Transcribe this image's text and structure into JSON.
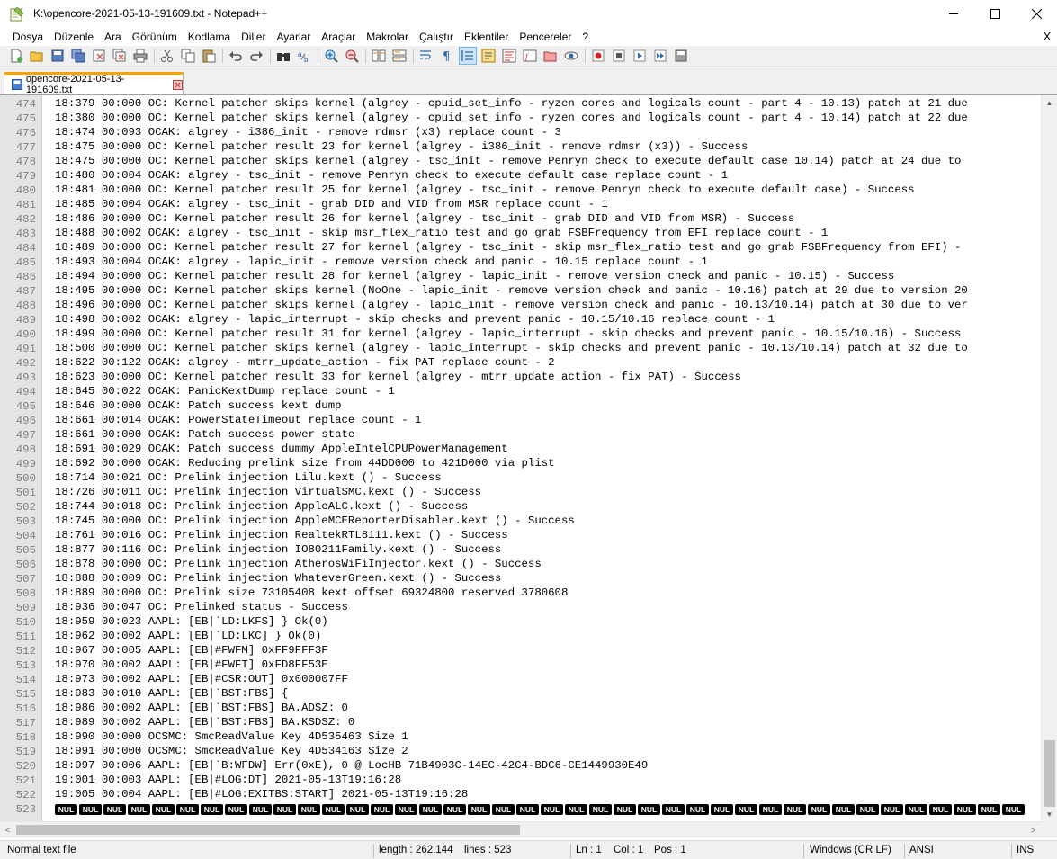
{
  "window": {
    "title": "K:\\opencore-2021-05-13-191609.txt - Notepad++",
    "minimize_icon": "minimize-icon",
    "maximize_icon": "maximize-icon",
    "close_icon": "close-icon"
  },
  "menu": {
    "items": [
      "Dosya",
      "Düzenle",
      "Ara",
      "Görünüm",
      "Kodlama",
      "Diller",
      "Ayarlar",
      "Araçlar",
      "Makrolar",
      "Çalıştır",
      "Eklentiler",
      "Pencereler",
      "?"
    ],
    "close_label": "X"
  },
  "toolbar": {
    "buttons": [
      "new-file",
      "open-file",
      "save",
      "save-all",
      "close",
      "close-all",
      "print",
      "cut",
      "copy",
      "paste",
      "undo",
      "redo",
      "find",
      "replace",
      "zoom-in",
      "zoom-out",
      "sync-vertical",
      "sync-horizontal",
      "word-wrap",
      "show-all-chars",
      "indent-guide",
      "user-lang",
      "doc-map",
      "function-list",
      "folder-as-workspace",
      "monitoring",
      "record-macro",
      "stop-record",
      "play-macro",
      "run-macro-multiple",
      "save-macro"
    ]
  },
  "tab": {
    "label": "opencore-2021-05-13-191609.txt"
  },
  "editor": {
    "lines": [
      {
        "n": "474",
        "t": "18:379 00:000 OC: Kernel patcher skips kernel (algrey - cpuid_set_info - ryzen cores and logicals count - part 4 - 10.13) patch at 21 due"
      },
      {
        "n": "475",
        "t": "18:380 00:000 OC: Kernel patcher skips kernel (algrey - cpuid_set_info - ryzen cores and logicals count - part 4 - 10.14) patch at 22 due"
      },
      {
        "n": "476",
        "t": "18:474 00:093 OCAK: algrey - i386_init - remove rdmsr (x3) replace count - 3"
      },
      {
        "n": "477",
        "t": "18:475 00:000 OC: Kernel patcher result 23 for kernel (algrey - i386_init - remove rdmsr (x3)) - Success"
      },
      {
        "n": "478",
        "t": "18:475 00:000 OC: Kernel patcher skips kernel (algrey - tsc_init - remove Penryn check to execute default case 10.14) patch at 24 due to"
      },
      {
        "n": "479",
        "t": "18:480 00:004 OCAK: algrey - tsc_init - remove Penryn check to execute default case replace count - 1"
      },
      {
        "n": "480",
        "t": "18:481 00:000 OC: Kernel patcher result 25 for kernel (algrey - tsc_init - remove Penryn check to execute default case) - Success"
      },
      {
        "n": "481",
        "t": "18:485 00:004 OCAK: algrey - tsc_init - grab DID and VID from MSR replace count - 1"
      },
      {
        "n": "482",
        "t": "18:486 00:000 OC: Kernel patcher result 26 for kernel (algrey - tsc_init - grab DID and VID from MSR) - Success"
      },
      {
        "n": "483",
        "t": "18:488 00:002 OCAK: algrey - tsc_init - skip msr_flex_ratio test and go grab FSBFrequency from EFI replace count - 1"
      },
      {
        "n": "484",
        "t": "18:489 00:000 OC: Kernel patcher result 27 for kernel (algrey - tsc_init - skip msr_flex_ratio test and go grab FSBFrequency from EFI) -"
      },
      {
        "n": "485",
        "t": "18:493 00:004 OCAK: algrey - lapic_init - remove version check and panic - 10.15 replace count - 1"
      },
      {
        "n": "486",
        "t": "18:494 00:000 OC: Kernel patcher result 28 for kernel (algrey - lapic_init - remove version check and panic - 10.15) - Success"
      },
      {
        "n": "487",
        "t": "18:495 00:000 OC: Kernel patcher skips kernel (NoOne - lapic_init - remove version check and panic - 10.16) patch at 29 due to version 20"
      },
      {
        "n": "488",
        "t": "18:496 00:000 OC: Kernel patcher skips kernel (algrey - lapic_init - remove version check and panic - 10.13/10.14) patch at 30 due to ver"
      },
      {
        "n": "489",
        "t": "18:498 00:002 OCAK: algrey - lapic_interrupt - skip checks and prevent panic - 10.15/10.16 replace count - 1"
      },
      {
        "n": "490",
        "t": "18:499 00:000 OC: Kernel patcher result 31 for kernel (algrey - lapic_interrupt - skip checks and prevent panic - 10.15/10.16) - Success"
      },
      {
        "n": "491",
        "t": "18:500 00:000 OC: Kernel patcher skips kernel (algrey - lapic_interrupt - skip checks and prevent panic - 10.13/10.14) patch at 32 due to"
      },
      {
        "n": "492",
        "t": "18:622 00:122 OCAK: algrey - mtrr_update_action - fix PAT replace count - 2"
      },
      {
        "n": "493",
        "t": "18:623 00:000 OC: Kernel patcher result 33 for kernel (algrey - mtrr_update_action - fix PAT) - Success"
      },
      {
        "n": "494",
        "t": "18:645 00:022 OCAK: PanicKextDump replace count - 1"
      },
      {
        "n": "495",
        "t": "18:646 00:000 OCAK: Patch success kext dump"
      },
      {
        "n": "496",
        "t": "18:661 00:014 OCAK: PowerStateTimeout replace count - 1"
      },
      {
        "n": "497",
        "t": "18:661 00:000 OCAK: Patch success power state"
      },
      {
        "n": "498",
        "t": "18:691 00:029 OCAK: Patch success dummy AppleIntelCPUPowerManagement"
      },
      {
        "n": "499",
        "t": "18:692 00:000 OCAK: Reducing prelink size from 44DD000 to 421D000 via plist"
      },
      {
        "n": "500",
        "t": "18:714 00:021 OC: Prelink injection Lilu.kext () - Success"
      },
      {
        "n": "501",
        "t": "18:726 00:011 OC: Prelink injection VirtualSMC.kext () - Success"
      },
      {
        "n": "502",
        "t": "18:744 00:018 OC: Prelink injection AppleALC.kext () - Success"
      },
      {
        "n": "503",
        "t": "18:745 00:000 OC: Prelink injection AppleMCEReporterDisabler.kext () - Success"
      },
      {
        "n": "504",
        "t": "18:761 00:016 OC: Prelink injection RealtekRTL8111.kext () - Success"
      },
      {
        "n": "505",
        "t": "18:877 00:116 OC: Prelink injection IO80211Family.kext () - Success"
      },
      {
        "n": "506",
        "t": "18:878 00:000 OC: Prelink injection AtherosWiFiInjector.kext () - Success"
      },
      {
        "n": "507",
        "t": "18:888 00:009 OC: Prelink injection WhateverGreen.kext () - Success"
      },
      {
        "n": "508",
        "t": "18:889 00:000 OC: Prelink size 73105408 kext offset 69324800 reserved 3780608"
      },
      {
        "n": "509",
        "t": "18:936 00:047 OC: Prelinked status - Success"
      },
      {
        "n": "510",
        "t": "18:959 00:023 AAPL: [EB|`LD:LKFS] } Ok(0)"
      },
      {
        "n": "511",
        "t": "18:962 00:002 AAPL: [EB|`LD:LKC] } Ok(0)"
      },
      {
        "n": "512",
        "t": "18:967 00:005 AAPL: [EB|#FWFM] 0xFF9FFF3F"
      },
      {
        "n": "513",
        "t": "18:970 00:002 AAPL: [EB|#FWFT] 0xFD8FF53E"
      },
      {
        "n": "514",
        "t": "18:973 00:002 AAPL: [EB|#CSR:OUT] 0x000007FF"
      },
      {
        "n": "515",
        "t": "18:983 00:010 AAPL: [EB|`BST:FBS] {"
      },
      {
        "n": "516",
        "t": "18:986 00:002 AAPL: [EB|`BST:FBS] BA.ADSZ: 0"
      },
      {
        "n": "517",
        "t": "18:989 00:002 AAPL: [EB|`BST:FBS] BA.KSDSZ: 0"
      },
      {
        "n": "518",
        "t": "18:990 00:000 OCSMC: SmcReadValue Key 4D535463 Size 1"
      },
      {
        "n": "519",
        "t": "18:991 00:000 OCSMC: SmcReadValue Key 4D534163 Size 2"
      },
      {
        "n": "520",
        "t": "18:997 00:006 AAPL: [EB|`B:WFDW] Err(0xE), 0 @ LocHB 71B4903C-14EC-42C4-BDC6-CE1449930E49"
      },
      {
        "n": "521",
        "t": "19:001 00:003 AAPL: [EB|#LOG:DT] 2021-05-13T19:16:28"
      },
      {
        "n": "522",
        "t": "19:005 00:004 AAPL: [EB|#LOG:EXITBS:START] 2021-05-13T19:16:28"
      }
    ],
    "last_line_number": "523",
    "nul_label": "NUL",
    "nul_count": 40
  },
  "status": {
    "file_type": "Normal text file",
    "length": "length : 262.144",
    "lines": "lines : 523",
    "ln": "Ln : 1",
    "col": "Col : 1",
    "pos": "Pos : 1",
    "eol": "Windows (CR LF)",
    "encoding": "ANSI",
    "mode": "INS"
  }
}
